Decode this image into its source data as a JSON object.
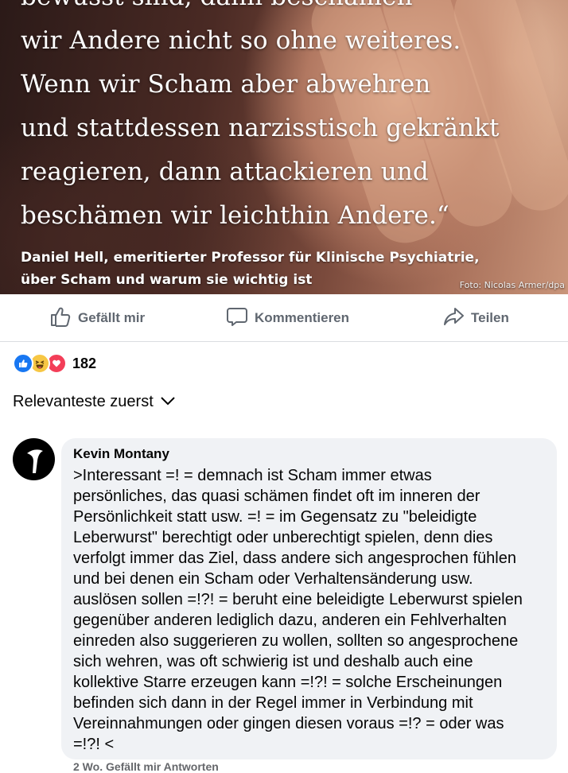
{
  "image_post": {
    "quote_lines": [
      "bewusst sind, dann beschämen",
      "wir Andere nicht so ohne weiteres.",
      "Wenn wir Scham aber abwehren",
      "und stattdessen narzisstisch gekränkt",
      "reagieren, dann attackieren und",
      "beschämen wir leichthin Andere.“"
    ],
    "attribution_line1": "Daniel Hell, emeritierter Professor für Klinische Psychiatrie,",
    "attribution_line2": "über Scham und warum sie wichtig ist",
    "photo_credit": "Foto: Nicolas Armer/dpa"
  },
  "actions": {
    "like_label": "Gefällt mir",
    "comment_label": "Kommentieren",
    "share_label": "Teilen",
    "icons": [
      "thumbs-up-icon",
      "comment-bubble-icon",
      "share-arrow-icon"
    ]
  },
  "reactions": {
    "types": [
      "like",
      "haha",
      "love"
    ],
    "count": "182",
    "colors": {
      "like": "#1877f2",
      "haha": "#f7c744",
      "love": "#f33e58"
    }
  },
  "sort": {
    "label": "Relevanteste zuerst",
    "icon": "chevron-down-icon"
  },
  "comment": {
    "author": "Kevin Montany",
    "text": ">Interessant =! = demnach ist Scham immer etwas\npersönliches, das quasi schämen findet oft im inneren der\nPersönlichkeit statt usw. =! = im Gegensatz zu \"beleidigte\nLeberwurst\" berechtigt oder unberechtigt spielen, denn dies\nverfolgt immer das Ziel, dass andere sich angesprochen fühlen\nund bei denen ein Scham oder Verhaltensänderung usw.\nauslösen sollen =!?! = beruht eine  beleidigte Leberwurst spielen\ngegenüber anderen lediglich dazu, anderen ein Fehlverhalten\neinreden also suggerieren zu wollen, sollten so angesprochene\nsich wehren, was oft schwierig ist und deshalb auch eine\nkollektive Starre erzeugen kann =!?! = solche Erscheinungen\nbefinden sich dann in der Regel immer in Verbindung mit\nVereinnahmungen oder gingen diesen voraus =!? = oder was\n=!?! <",
    "meta": "2 Wo.   Gefällt mir   Antworten"
  },
  "colors": {
    "text_primary": "#050505",
    "text_secondary": "#606770",
    "bubble_bg": "#f0f2f5",
    "divider": "#dadde1"
  }
}
